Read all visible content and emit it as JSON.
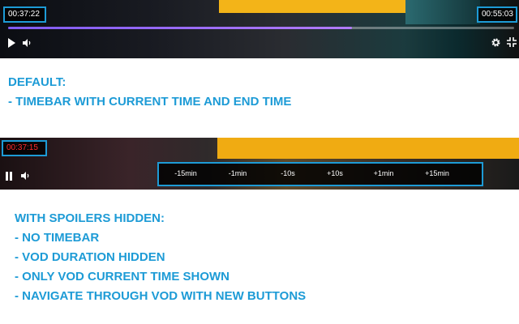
{
  "player_default": {
    "current_time": "00:37:22",
    "end_time": "00:55:03",
    "progress": 0.68,
    "progress_color": "#8b5cf6",
    "icons": [
      "play-icon",
      "volume-icon",
      "gear-icon",
      "collapse-icon"
    ]
  },
  "caption_default": {
    "lines": [
      "DEFAULT:",
      "- TIMEBAR WITH CURRENT TIME AND END TIME"
    ]
  },
  "player_spoilers": {
    "current_time": "00:37:15",
    "current_time_color": "#ff2b2b",
    "nav_buttons": [
      "-15min",
      "-1min",
      "-10s",
      "+10s",
      "+1min",
      "+15min"
    ],
    "icons": [
      "pause-icon",
      "volume-icon"
    ]
  },
  "caption_spoilers": {
    "lines": [
      "WITH SPOILERS HIDDEN:",
      "- NO TIMEBAR",
      "- VOD DURATION HIDDEN",
      "- ONLY VOD CURRENT TIME SHOWN",
      "- NAVIGATE THROUGH VOD WITH NEW BUTTONS"
    ]
  },
  "colors": {
    "highlight": "#1d9bd6",
    "caption": "#1d9bd6"
  }
}
